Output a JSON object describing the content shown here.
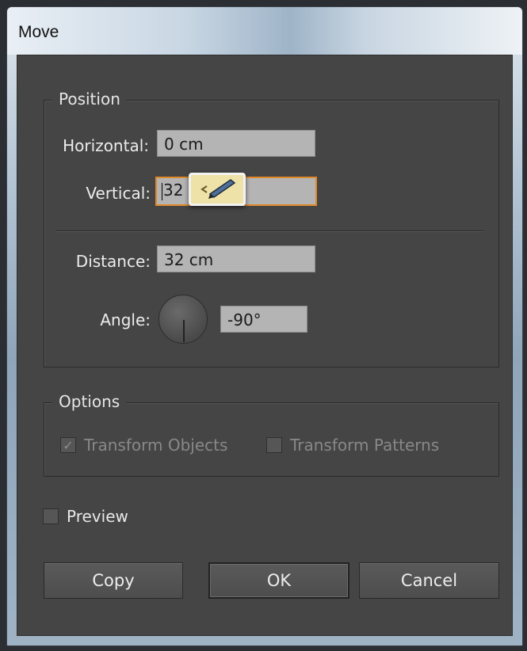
{
  "window": {
    "title": "Move"
  },
  "position": {
    "legend": "Position",
    "horizontal": {
      "label": "Horizontal:",
      "value": "0 cm"
    },
    "vertical": {
      "label": "Vertical:",
      "value": "32 cm"
    },
    "distance": {
      "label": "Distance:",
      "value": "32 cm"
    },
    "angle": {
      "label": "Angle:",
      "value": "-90°"
    }
  },
  "options": {
    "legend": "Options",
    "transform_objects": {
      "label": "Transform Objects",
      "checked": true,
      "enabled": false
    },
    "transform_patterns": {
      "label": "Transform Patterns",
      "checked": false,
      "enabled": false
    }
  },
  "preview": {
    "label": "Preview",
    "checked": false
  },
  "buttons": {
    "copy": "Copy",
    "ok": "OK",
    "cancel": "Cancel"
  },
  "icons": {
    "tooltip": "smart-guide-tooltip-icon",
    "checkmark": "checkmark-icon"
  },
  "colors": {
    "focus_border": "#e08a2a",
    "dialog_bg": "#454545"
  }
}
